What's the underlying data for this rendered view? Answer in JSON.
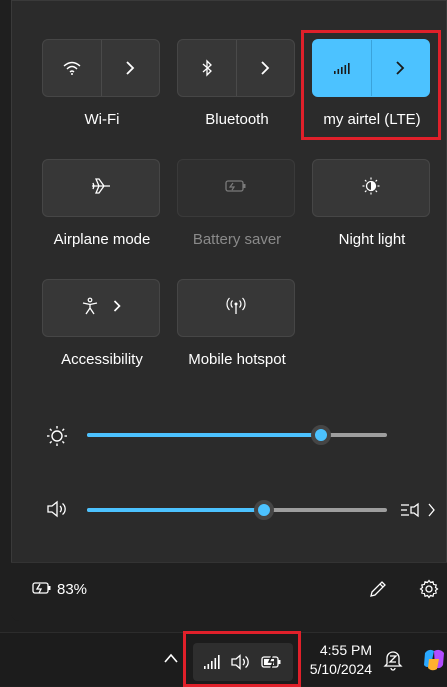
{
  "quick_settings": {
    "tiles": {
      "wifi": {
        "label": "Wi-Fi"
      },
      "bluetooth": {
        "label": "Bluetooth"
      },
      "cellular": {
        "label": "my airtel (LTE)"
      },
      "airplane": {
        "label": "Airplane mode"
      },
      "battery_saver": {
        "label": "Battery saver"
      },
      "night_light": {
        "label": "Night light"
      },
      "accessibility": {
        "label": "Accessibility"
      },
      "hotspot": {
        "label": "Mobile hotspot"
      }
    },
    "brightness": {
      "level": 0.78
    },
    "volume": {
      "level": 0.59
    },
    "battery": {
      "percent": "83%"
    },
    "colors": {
      "accent": "#4cc2ff",
      "highlight": "#e0202a"
    }
  },
  "taskbar": {
    "time": "4:55 PM",
    "date": "5/10/2024"
  }
}
